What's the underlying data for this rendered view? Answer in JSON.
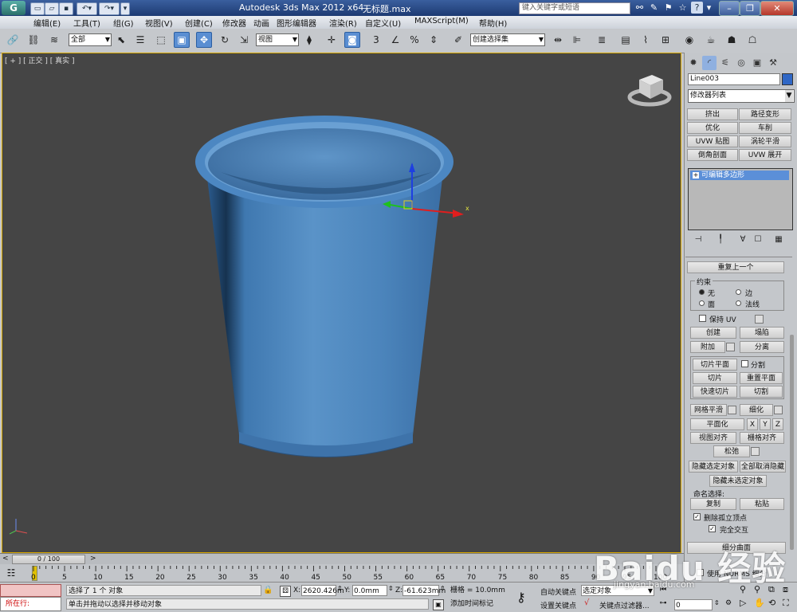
{
  "titlebar": {
    "logo": "G",
    "app_title": "Autodesk 3ds Max  2012 x64",
    "file_name": "无标题.max",
    "search_placeholder": "键入关键字或短语"
  },
  "menu": [
    "编辑(E)",
    "工具(T)",
    "组(G)",
    "视图(V)",
    "创建(C)",
    "修改器",
    "动画",
    "图形编辑器",
    "渲染(R)",
    "自定义(U)",
    "MAXScript(M)",
    "帮助(H)"
  ],
  "toolbar": {
    "selection_filter": "全部",
    "ref_coord": "视图",
    "named_selection": "创建选择集"
  },
  "viewport": {
    "label": "[ + ] [ 正交 ] [ 真实 ]",
    "gizmo_x_label": "x",
    "object_color": "#4a86c8"
  },
  "command_panel": {
    "object_name": "Line003",
    "object_color": "#2f67c6",
    "modifier_list": "修改器列表",
    "modifier_buttons": [
      "挤出",
      "路径变形",
      "优化",
      "车削",
      "UVW 贴图",
      "涡轮平滑",
      "倒角剖面",
      "UVW 展开"
    ],
    "stack_item": "可编辑多边形",
    "repeat_last": "重复上一个",
    "constraints": {
      "title": "约束",
      "none": "无",
      "edge": "边",
      "face": "面",
      "normal": "法线"
    },
    "preserve_uv": "保持 UV",
    "create": "创建",
    "collapse": "塌陷",
    "attach": "附加",
    "detach": "分离",
    "slice_plane": "切片平面",
    "split": "分割",
    "slice": "切片",
    "reset_plane": "重置平面",
    "quickslice": "快速切片",
    "cut": "切割",
    "meshsmooth": "网格平滑",
    "tessellate": "细化",
    "make_planar": "平面化",
    "x": "X",
    "y": "Y",
    "z": "Z",
    "view_align": "视图对齐",
    "grid_align": "栅格对齐",
    "relax": "松弛",
    "hide_selected": "隐藏选定对象",
    "unhide_all": "全部取消隐藏",
    "hide_unselected": "隐藏未选定对象",
    "named_selections": "命名选择:",
    "copy": "复制",
    "paste": "粘贴",
    "delete_isolated": "删除孤立顶点",
    "full_interactivity": "完全交互",
    "subdivision_surface": "细分曲面",
    "use_nurms": "使用 NURMS 细分"
  },
  "timeline": {
    "frame_display": "0 / 100",
    "ticks": [
      "0",
      "5",
      "10",
      "15",
      "20",
      "25",
      "30",
      "35",
      "40",
      "45",
      "50",
      "55",
      "60",
      "65",
      "70",
      "75",
      "80",
      "85",
      "90",
      "95",
      "100"
    ]
  },
  "status": {
    "running": "所在行:",
    "selection_status": "选择了 1 个 对象",
    "prompt": "单击并拖动以选择并移动对象",
    "x_label": "X:",
    "x_value": "2620.426m",
    "y_label": "Y:",
    "y_value": "0.0mm",
    "z_label": "Z:",
    "z_value": "-61.623mm",
    "grid": "栅格 = 10.0mm",
    "add_time_tag": "添加时间标记",
    "auto_key": "自动关键点",
    "set_key": "设置关键点",
    "selected": "选定对象",
    "key_filters": "关键点过滤器...",
    "frame": "0"
  },
  "watermark": {
    "brand": "Baidu 经验",
    "url": "jingyan.baidu.com"
  }
}
